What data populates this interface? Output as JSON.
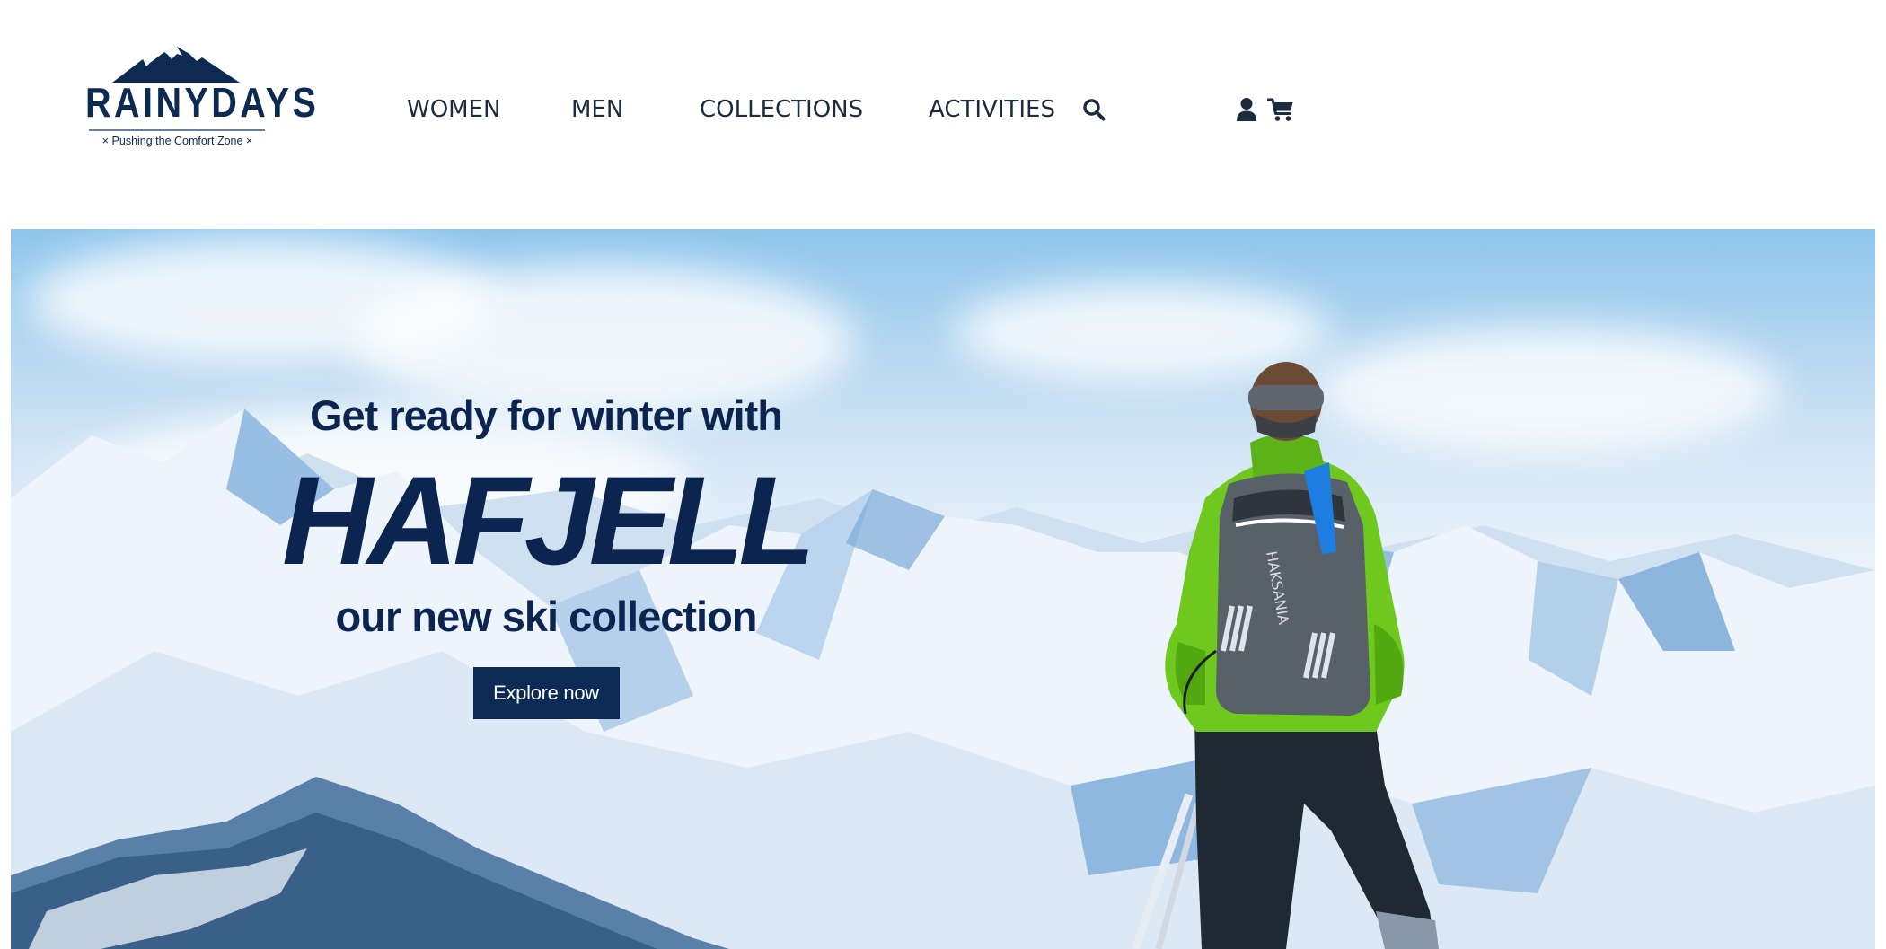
{
  "header": {
    "logo": {
      "wordmark": "RAINYDAYS",
      "tagline": "× Pushing the Comfort Zone ×",
      "icon": "mountain-logo-icon"
    },
    "nav": [
      {
        "label": "WOMEN"
      },
      {
        "label": "MEN"
      },
      {
        "label": "COLLECTIONS"
      },
      {
        "label": "ACTIVITIES"
      }
    ],
    "icons": {
      "search": "search-icon",
      "account": "user-icon",
      "cart": "cart-icon"
    }
  },
  "hero": {
    "subtitle": "Get ready for winter with",
    "title": "HAFJELL",
    "subtitle2": "our new ski collection",
    "cta_label": "Explore now"
  },
  "colors": {
    "brand_navy": "#0b2a55",
    "text_dark": "#1c2b3d",
    "background": "#ffffff"
  }
}
